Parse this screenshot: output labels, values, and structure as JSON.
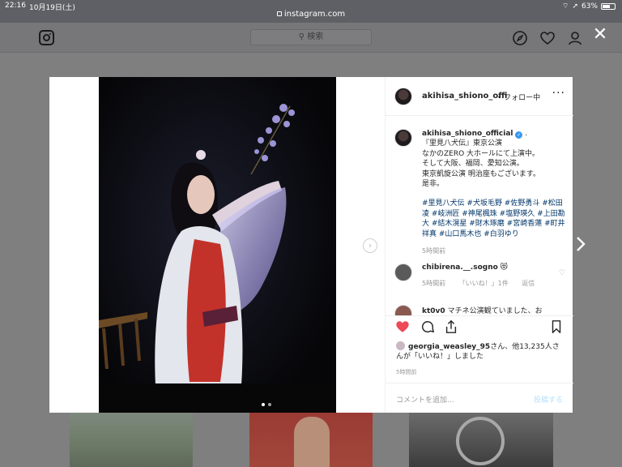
{
  "status": {
    "time": "22:16",
    "date": "10月19日(土)",
    "url": "instagram.com",
    "battery": "63%"
  },
  "header": {
    "search_placeholder": "検索"
  },
  "post": {
    "username_short": "akihisa_shiono_offi",
    "follow_label": "フォロー中",
    "caption_user": "akihisa_shiono_official",
    "caption_lines": [
      "『里見八犬伝』東京公演",
      "なかのZERO 大ホールにて上演中。",
      "そして大阪、福岡、愛知公演。",
      "東京凱旋公演 明治座もございます。",
      "是非。"
    ],
    "hashtags": "#里見八犬伝 #犬坂毛野 #佐野勇斗 #松田凌 #岐洲匠 #神尾楓珠 #塩野瑛久 #上田勘大 #結木滉星 #財木琢磨 #宮崎香蓮 #町井祥真 #山口馬木也 #白羽ゆり",
    "caption_time": "5時間前",
    "comment1_user": "chibirena.__.sogno",
    "comment1_emoji": "😻",
    "comment1_time": "5時間前",
    "comment1_likes": "「いいね！」1件",
    "comment1_reply": "返信",
    "comment2_user": "kt0v0",
    "comment2_text": "マチネ公演観ていました、お",
    "likes_user": "georgia_weasley_95",
    "likes_text": "さん、他13,235人さんが「いいね！」しました",
    "post_time": "5時間前",
    "comment_placeholder": "コメントを追加...",
    "post_button": "投稿する"
  },
  "colors": {
    "like_red": "#ed4956",
    "link": "#003569",
    "verified": "#3897f0"
  }
}
